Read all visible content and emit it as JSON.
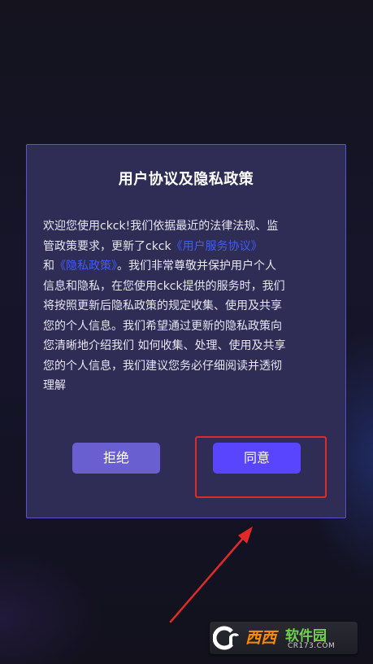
{
  "dialog": {
    "title": "用户协议及隐私政策",
    "body_intro": "欢迎您使用ckck!我们依据最近的法律法规、监管政策要求，更新了ckck",
    "terms_link": "《用户服务协议》",
    "conjunction": "和",
    "privacy_link": "《隐私政策》",
    "body_rest": "。我们非常尊敬并保护用户个人信息和隐私，在您使用ckck提供的服务时，我们将按照更新后隐私政策的规定收集、使用及共享您的个人信息。我们希望通过更新的隐私政策向您清晰地介绍我们 如何收集、处理、使用及共享您的个人信息，我们建议您务必仔细阅读并透彻理解",
    "reject_label": "拒绝",
    "agree_label": "同意"
  },
  "watermark": {
    "xixi": "西西",
    "brand": "软件园",
    "url": "CR173.COM"
  },
  "colors": {
    "dialog_bg": "#2f2c55",
    "dialog_border": "#5b54c8",
    "link": "#3f5cff",
    "reject_button": "#6a5fd1",
    "agree_button": "#5a45ff",
    "annotation": "#e02a2a"
  }
}
